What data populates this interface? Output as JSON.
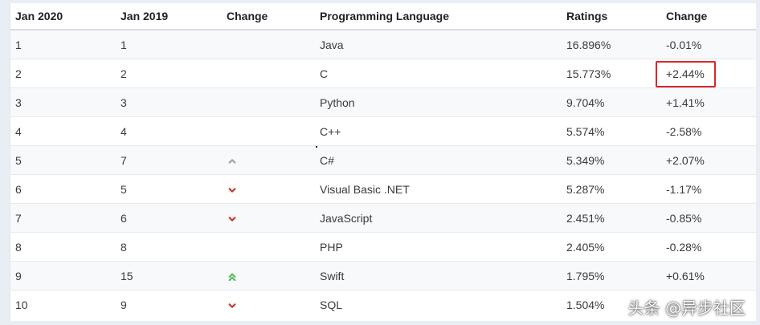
{
  "table": {
    "headers": [
      "Jan 2020",
      "Jan 2019",
      "Change",
      "Programming Language",
      "Ratings",
      "Change"
    ],
    "rows": [
      {
        "jan2020": "1",
        "jan2019": "1",
        "trend": "none",
        "language": "Java",
        "rating": "16.896%",
        "change": "-0.01%"
      },
      {
        "jan2020": "2",
        "jan2019": "2",
        "trend": "none",
        "language": "C",
        "rating": "15.773%",
        "change": "+2.44%"
      },
      {
        "jan2020": "3",
        "jan2019": "3",
        "trend": "none",
        "language": "Python",
        "rating": "9.704%",
        "change": "+1.41%"
      },
      {
        "jan2020": "4",
        "jan2019": "4",
        "trend": "none",
        "language": "C++",
        "rating": "5.574%",
        "change": "-2.58%"
      },
      {
        "jan2020": "5",
        "jan2019": "7",
        "trend": "up",
        "language": "C#",
        "rating": "5.349%",
        "change": "+2.07%"
      },
      {
        "jan2020": "6",
        "jan2019": "5",
        "trend": "down",
        "language": "Visual Basic .NET",
        "rating": "5.287%",
        "change": "-1.17%"
      },
      {
        "jan2020": "7",
        "jan2019": "6",
        "trend": "down",
        "language": "JavaScript",
        "rating": "2.451%",
        "change": "-0.85%"
      },
      {
        "jan2020": "8",
        "jan2019": "8",
        "trend": "none",
        "language": "PHP",
        "rating": "2.405%",
        "change": "-0.28%"
      },
      {
        "jan2020": "9",
        "jan2019": "15",
        "trend": "double-up",
        "language": "Swift",
        "rating": "1.795%",
        "change": "+0.61%"
      },
      {
        "jan2020": "10",
        "jan2019": "9",
        "trend": "down",
        "language": "SQL",
        "rating": "1.504%",
        "change": ""
      }
    ]
  },
  "highlight": {
    "row": 2,
    "color": "#d9262b"
  },
  "colors": {
    "up_arrow": "#9aa5a0",
    "double_up_arrow": "#5cb85c",
    "down_arrow": "#c0392b"
  },
  "watermark": {
    "text": "头条 @异步社区"
  }
}
